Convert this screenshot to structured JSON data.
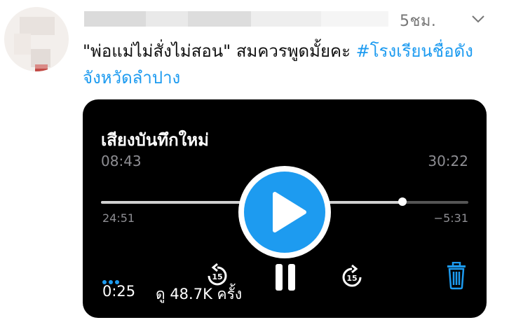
{
  "tweet": {
    "time_ago": "5ชม.",
    "text_plain": "\"พ่อแม่ไม่สั่งไม่สอน\" สมควรพูดมั้ยคะ ",
    "hashtag": "#โรงเรียนชื่อดังจังหวัดลำปาง"
  },
  "icons": {
    "caret": "chevron-down-icon",
    "play": "play-icon",
    "pause": "pause-icon",
    "skip_back": "rewind-15-icon",
    "skip_fwd": "forward-15-icon",
    "delete": "trash-icon",
    "more": "more-dots-icon"
  },
  "player": {
    "title": "เสียงบันทึกใหม่",
    "recorded_time": "08:43",
    "total_time": "30:22",
    "elapsed": "24:51",
    "remaining": "−5:31",
    "progress": 0.82,
    "skip_label": "15",
    "accent_color": "#1d9bf0"
  },
  "video_overlay": {
    "time": "0:25",
    "views": "ดู 48.7K ครั้ง"
  }
}
